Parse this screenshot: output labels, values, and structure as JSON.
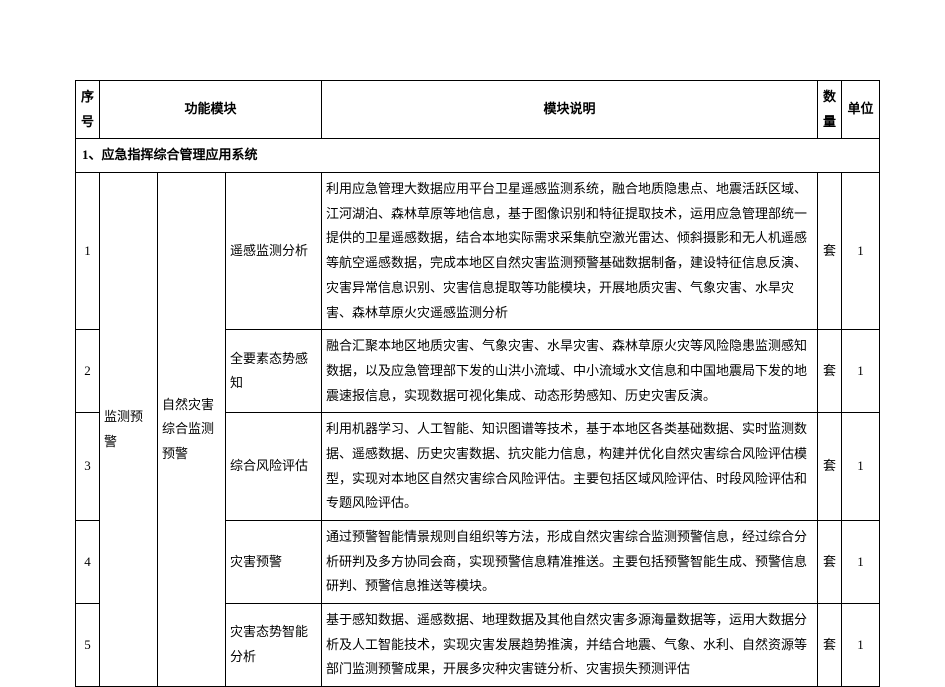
{
  "headers": {
    "seq": "序号",
    "module": "功能模块",
    "desc": "模块说明",
    "qty": "数量",
    "unit": "单位"
  },
  "section": "1、应急指挥综合管理应用系统",
  "module_l1": "监测预警",
  "module_l2": "自然灾害综合监测预警",
  "rows": [
    {
      "seq": "1",
      "mod3": "遥感监测分析",
      "desc": "利用应急管理大数据应用平台卫星遥感监测系统，融合地质隐患点、地震活跃区域、江河湖泊、森林草原等地信息，基于图像识别和特征提取技术，运用应急管理部统一提供的卫星遥感数据，结合本地实际需求采集航空激光雷达、倾斜摄影和无人机遥感等航空遥感数据，完成本地区自然灾害监测预警基础数据制备，建设特征信息反演、灾害异常信息识别、灾害信息提取等功能模块，开展地质灾害、气象灾害、水旱灾害、森林草原火灾遥感监测分析",
      "qty": "套",
      "unit": "1"
    },
    {
      "seq": "2",
      "mod3": "全要素态势感知",
      "desc": "融合汇聚本地区地质灾害、气象灾害、水旱灾害、森林草原火灾等风险隐患监测感知数据，以及应急管理部下发的山洪小流域、中小流域水文信息和中国地震局下发的地震速报信息，实现数据可视化集成、动态形势感知、历史灾害反演。",
      "qty": "套",
      "unit": "1"
    },
    {
      "seq": "3",
      "mod3": "综合风险评估",
      "desc": "利用机器学习、人工智能、知识图谱等技术，基于本地区各类基础数据、实时监测数据、遥感数据、历史灾害数据、抗灾能力信息，构建并优化自然灾害综合风险评估模型，实现对本地区自然灾害综合风险评估。主要包括区域风险评估、时段风险评估和专题风险评估。",
      "qty": "套",
      "unit": "1"
    },
    {
      "seq": "4",
      "mod3": "灾害预警",
      "desc": "通过预警智能情景规则自组织等方法，形成自然灾害综合监测预警信息，经过综合分析研判及多方协同会商，实现预警信息精准推送。主要包括预警智能生成、预警信息研判、预警信息推送等模块。",
      "qty": "套",
      "unit": "1"
    },
    {
      "seq": "5",
      "mod3": "灾害态势智能分析",
      "desc": "基于感知数据、遥感数据、地理数据及其他自然灾害多源海量数据等，运用大数据分析及人工智能技术，实现灾害发展趋势推演，并结合地震、气象、水利、自然资源等部门监测预警成果，开展多灾种灾害链分析、灾害损失预测评估",
      "qty": "套",
      "unit": "1"
    }
  ]
}
